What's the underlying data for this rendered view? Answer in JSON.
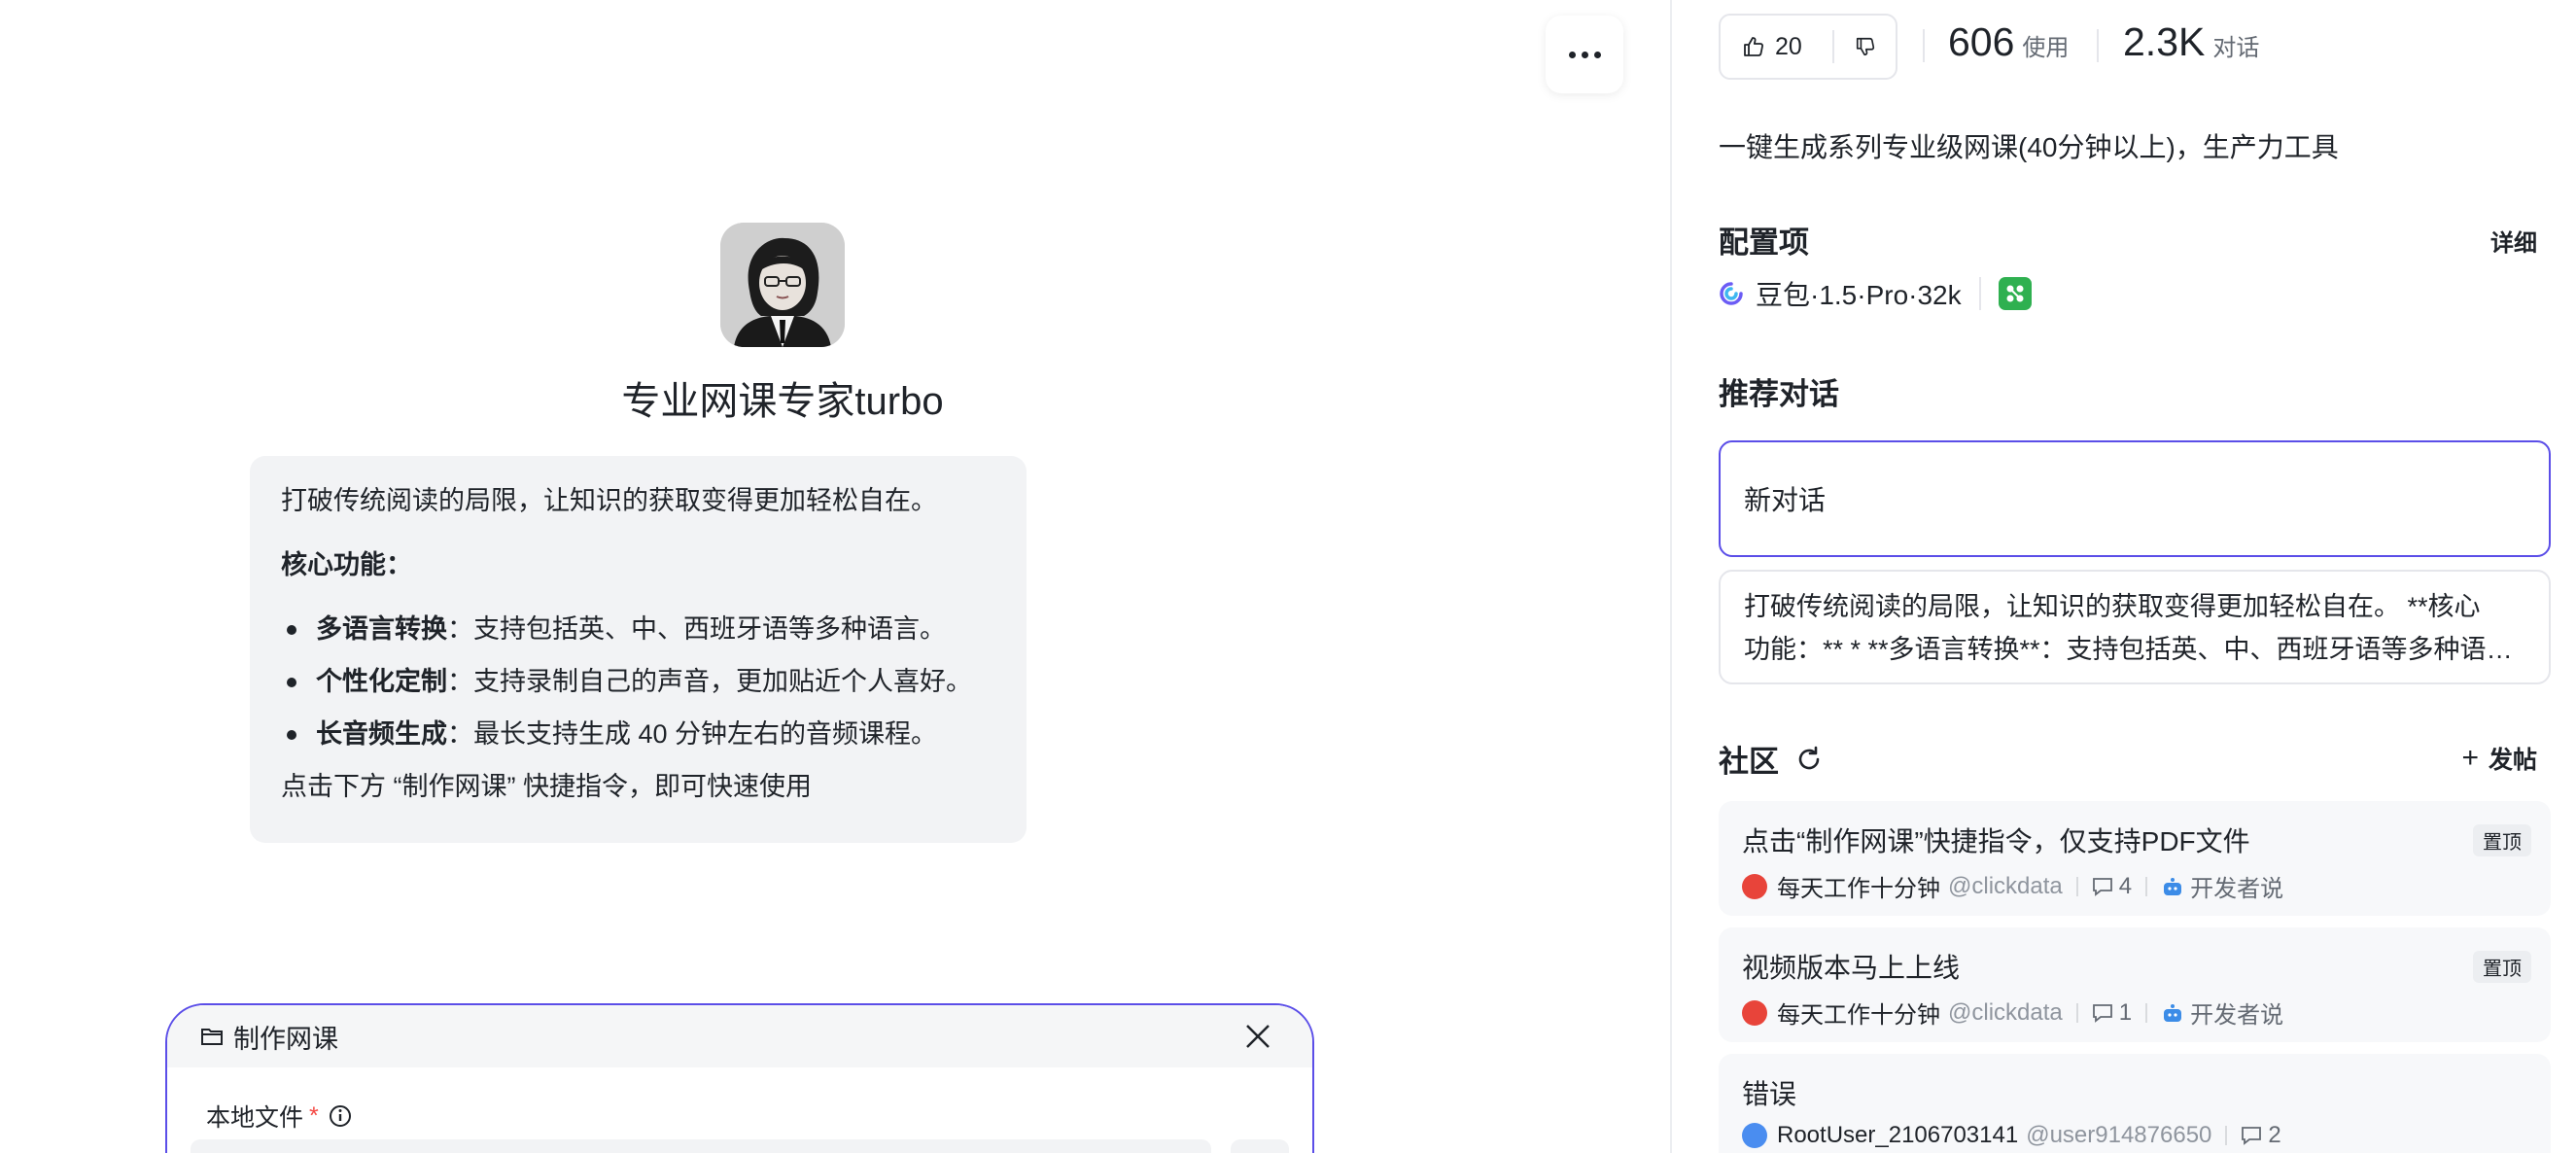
{
  "bot": {
    "name": "专业网课专家turbo",
    "intro": {
      "line1": "打破传统阅读的局限，让知识的获取变得更加轻松自在。",
      "core_title": "核心功能：",
      "features": [
        {
          "title": "多语言转换",
          "text": "：支持包括英、中、西班牙语等多种语言。"
        },
        {
          "title": "个性化定制",
          "text": "：支持录制自己的声音，更加贴近个人喜好。"
        },
        {
          "title": "长音频生成",
          "text": "：最长支持生成 40 分钟左右的音频课程。"
        }
      ],
      "tip": "点击下方 “制作网课” 快捷指令，即可快速使用"
    }
  },
  "panel": {
    "title": "制作网课",
    "field_label": "本地文件",
    "required_mark": "*"
  },
  "sidebar": {
    "likes": "20",
    "usage_num": "606",
    "usage_unit": "使用",
    "chat_num": "2.3K",
    "chat_unit": "对话",
    "description": "一键生成系列专业级网课(40分钟以上)，生产力工具",
    "config_title": "配置项",
    "detail_label": "详细",
    "model_name": "豆包·1.5·Pro·32k",
    "recommend_title": "推荐对话",
    "new_chat": "新对话",
    "suggest_line1": "打破传统阅读的局限，让知识的获取变得更加轻松自在。 **核心",
    "suggest_line2": "功能：** * **多语言转换**：支持包括英、中、西班牙语等多种语言。",
    "community_title": "社区",
    "post_label": "发帖",
    "posts": [
      {
        "title": "点击“制作网课”快捷指令，仅支持PDF文件",
        "author": "每天工作十分钟",
        "handle": "@clickdata",
        "comments": "4",
        "category": "开发者说",
        "badge": "置顶"
      },
      {
        "title": "视频版本马上上线",
        "author": "每天工作十分钟",
        "handle": "@clickdata",
        "comments": "1",
        "category": "开发者说",
        "badge": "置顶"
      },
      {
        "title": "错误",
        "author": "RootUser_2106703141",
        "handle": "@user914876650",
        "comments": "2"
      }
    ]
  },
  "colors": {
    "accent": "#5b4ee8",
    "plugin_green": "#2fb050",
    "required_red": "#f54a45"
  }
}
